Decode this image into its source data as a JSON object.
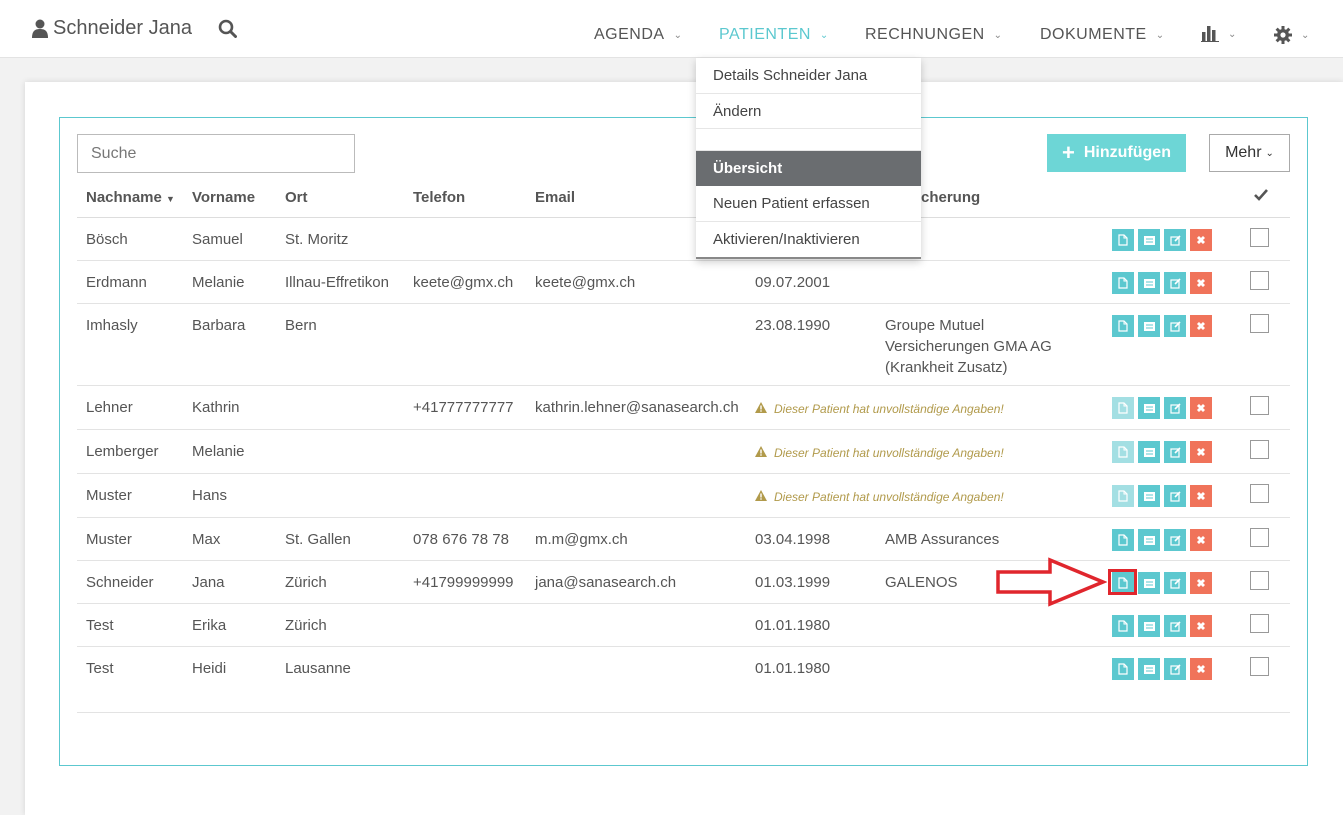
{
  "user": {
    "name": "Schneider Jana"
  },
  "nav": {
    "agenda": "AGENDA",
    "patienten": "PATIENTEN",
    "rechnungen": "RECHNUNGEN",
    "dokumente": "DOKUMENTE"
  },
  "dropdown": {
    "items": [
      "Details Schneider Jana",
      "Ändern",
      "Übersicht",
      "Neuen Patient erfassen",
      "Aktivieren/Inaktivieren"
    ]
  },
  "search": {
    "placeholder": "Suche"
  },
  "toolbar": {
    "add_label": "Hinzufügen",
    "more_label": "Mehr"
  },
  "table": {
    "headers": {
      "nachname": "Nachname",
      "vorname": "Vorname",
      "ort": "Ort",
      "telefon": "Telefon",
      "email": "Email",
      "versicherung": "cherung"
    },
    "rows": [
      {
        "nachname": "Bösch",
        "vorname": "Samuel",
        "ort": "St. Moritz",
        "telefon": "",
        "email": "",
        "geburtsdatum": "",
        "versicherung": "",
        "warning": ""
      },
      {
        "nachname": "Erdmann",
        "vorname": "Melanie",
        "ort": "Illnau-Effretikon",
        "telefon": "keete@gmx.ch",
        "email": "keete@gmx.ch",
        "geburtsdatum": "09.07.2001",
        "versicherung": "",
        "warning": ""
      },
      {
        "nachname": "Imhasly",
        "vorname": "Barbara",
        "ort": "Bern",
        "telefon": "",
        "email": "",
        "geburtsdatum": "23.08.1990",
        "versicherung": "Groupe Mutuel Versicherungen GMA AG (Krankheit Zusatz)",
        "warning": ""
      },
      {
        "nachname": "Lehner",
        "vorname": "Kathrin",
        "ort": "",
        "telefon": "+41777777777",
        "email": "kathrin.lehner@sanasearch.ch",
        "geburtsdatum": "",
        "versicherung": "",
        "warning": "Dieser Patient hat unvollständige Angaben!"
      },
      {
        "nachname": "Lemberger",
        "vorname": "Melanie",
        "ort": "",
        "telefon": "",
        "email": "",
        "geburtsdatum": "",
        "versicherung": "",
        "warning": "Dieser Patient hat unvollständige Angaben!"
      },
      {
        "nachname": "Muster",
        "vorname": "Hans",
        "ort": "",
        "telefon": "",
        "email": "",
        "geburtsdatum": "",
        "versicherung": "",
        "warning": "Dieser Patient hat unvollständige Angaben!"
      },
      {
        "nachname": "Muster",
        "vorname": "Max",
        "ort": "St. Gallen",
        "telefon": "078 676 78 78",
        "email": "m.m@gmx.ch",
        "geburtsdatum": "03.04.1998",
        "versicherung": "AMB Assurances",
        "warning": ""
      },
      {
        "nachname": "Schneider",
        "vorname": "Jana",
        "ort": "Zürich",
        "telefon": "+41799999999",
        "email": "jana@sanasearch.ch",
        "geburtsdatum": "01.03.1999",
        "versicherung": "GALENOS",
        "warning": ""
      },
      {
        "nachname": "Test",
        "vorname": "Erika",
        "ort": "Zürich",
        "telefon": "",
        "email": "",
        "geburtsdatum": "01.01.1980",
        "versicherung": "",
        "warning": ""
      },
      {
        "nachname": "Test",
        "vorname": "Heidi",
        "ort": "Lausanne",
        "telefon": "",
        "email": "",
        "geburtsdatum": "01.01.1980",
        "versicherung": "",
        "warning": ""
      }
    ]
  },
  "colors": {
    "accent": "#5cc8cf",
    "danger": "#f0735a",
    "warning": "#b19a4b",
    "annotation": "#e0262d"
  }
}
